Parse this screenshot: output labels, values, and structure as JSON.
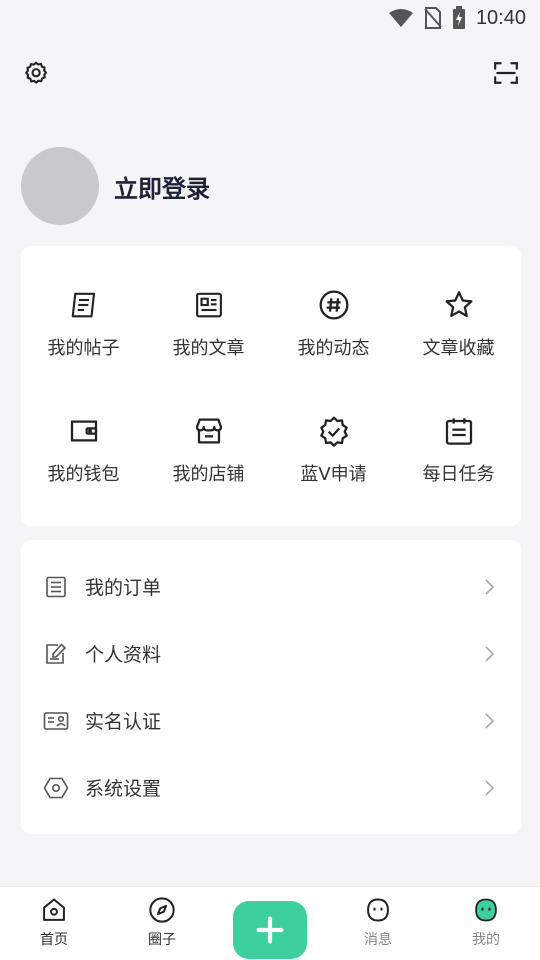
{
  "status_bar": {
    "time": "10:40"
  },
  "header": {
    "settings_icon": "gear-icon",
    "scan_icon": "scan-icon"
  },
  "profile": {
    "login_label": "立即登录"
  },
  "grid": {
    "items": [
      {
        "label": "我的帖子",
        "icon": "post-icon"
      },
      {
        "label": "我的文章",
        "icon": "article-icon"
      },
      {
        "label": "我的动态",
        "icon": "hashtag-icon"
      },
      {
        "label": "文章收藏",
        "icon": "star-icon"
      },
      {
        "label": "我的钱包",
        "icon": "wallet-icon"
      },
      {
        "label": "我的店铺",
        "icon": "shop-icon"
      },
      {
        "label": "蓝V申请",
        "icon": "verified-badge-icon"
      },
      {
        "label": "每日任务",
        "icon": "calendar-task-icon"
      }
    ]
  },
  "list": {
    "items": [
      {
        "label": "我的订单",
        "icon": "order-icon"
      },
      {
        "label": "个人资料",
        "icon": "edit-profile-icon"
      },
      {
        "label": "实名认证",
        "icon": "id-card-icon"
      },
      {
        "label": "系统设置",
        "icon": "hexagon-settings-icon"
      }
    ]
  },
  "bottom_nav": {
    "items": [
      {
        "label": "首页",
        "icon": "home-icon"
      },
      {
        "label": "圈子",
        "icon": "compass-icon"
      },
      {
        "label": "",
        "icon": "plus-icon"
      },
      {
        "label": "消息",
        "icon": "message-face-icon"
      },
      {
        "label": "我的",
        "icon": "profile-face-icon"
      }
    ],
    "accent_color": "#3ecf9f"
  }
}
